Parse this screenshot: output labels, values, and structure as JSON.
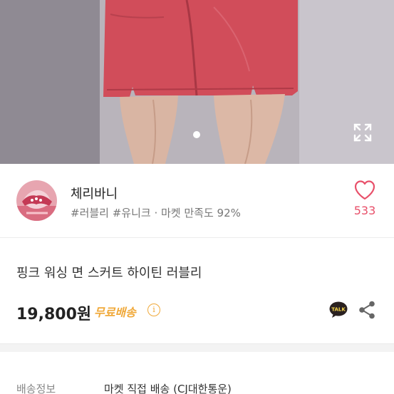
{
  "product_image": {
    "alt": "pink washed skirt photo",
    "carousel_dots": 1,
    "expand_icon": "expand-arrows-icon"
  },
  "seller": {
    "name": "체리바니",
    "tags": "#러블리 #유니크 · 마켓 만족도 92%",
    "like_count": "533",
    "like_icon": "heart-outline-icon",
    "avatar_icon": "shop-avatar"
  },
  "product": {
    "title": "핑크 워싱 면 스커트 하이틴 러블리",
    "price": "19,800원",
    "free_shipping": "무료배송",
    "info_icon": "info-circle-icon",
    "talk_icon": "kakao-talk-icon",
    "talk_label": "TALK",
    "share_icon": "share-icon"
  },
  "delivery": {
    "label": "배송정보",
    "value": "마켓 직접 배송 (CJ대한통운)"
  },
  "colors": {
    "like": "#e8506a",
    "free_shipping": "#f0a93a",
    "skirt": "#d34f5c"
  }
}
